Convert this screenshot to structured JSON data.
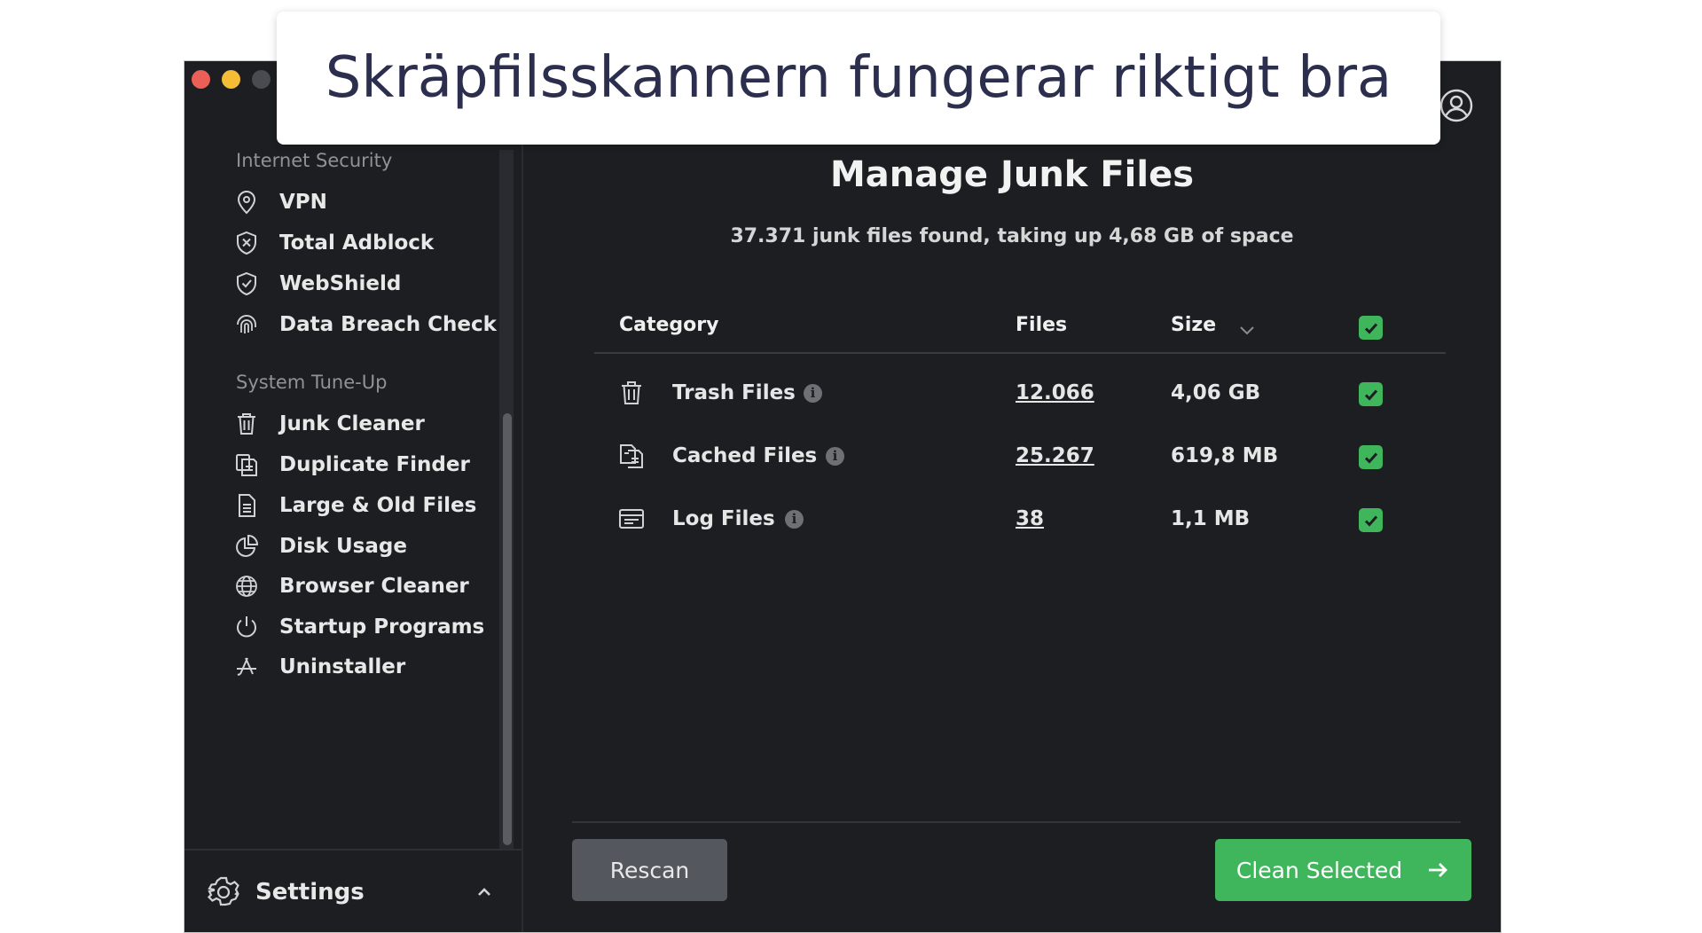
{
  "caption": "Skräpfilsskannern fungerar riktigt bra",
  "window": {
    "traffic_colors": [
      "#ec5f57",
      "#f5bd36",
      "#4a4b50"
    ]
  },
  "sidebar": {
    "sections": [
      {
        "title": "Internet Security",
        "items": [
          {
            "label": "VPN",
            "icon": "location-pin-icon"
          },
          {
            "label": "Total Adblock",
            "icon": "shield-x-icon"
          },
          {
            "label": "WebShield",
            "icon": "shield-check-icon"
          },
          {
            "label": "Data Breach Check",
            "icon": "fingerprint-icon"
          }
        ]
      },
      {
        "title": "System Tune-Up",
        "items": [
          {
            "label": "Junk Cleaner",
            "icon": "trash-icon"
          },
          {
            "label": "Duplicate Finder",
            "icon": "duplicate-icon"
          },
          {
            "label": "Large & Old Files",
            "icon": "document-icon"
          },
          {
            "label": "Disk Usage",
            "icon": "pie-chart-icon"
          },
          {
            "label": "Browser Cleaner",
            "icon": "globe-icon"
          },
          {
            "label": "Startup Programs",
            "icon": "power-icon"
          },
          {
            "label": "Uninstaller",
            "icon": "app-store-icon"
          }
        ]
      }
    ],
    "settings_label": "Settings"
  },
  "main": {
    "title": "Manage Junk Files",
    "subtitle": "37.371 junk files found, taking up 4,68 GB of space",
    "columns": {
      "category": "Category",
      "files": "Files",
      "size": "Size"
    },
    "rows": [
      {
        "label": "Trash Files",
        "files": "12.066",
        "size": "4,06 GB",
        "icon": "trash-icon"
      },
      {
        "label": "Cached Files",
        "files": "25.267",
        "size": "619,8 MB",
        "icon": "cached-files-icon"
      },
      {
        "label": "Log Files",
        "files": "38",
        "size": "1,1 MB",
        "icon": "log-file-icon"
      }
    ],
    "rescan_label": "Rescan",
    "clean_label": "Clean Selected",
    "accent_color": "#3fb55c"
  }
}
